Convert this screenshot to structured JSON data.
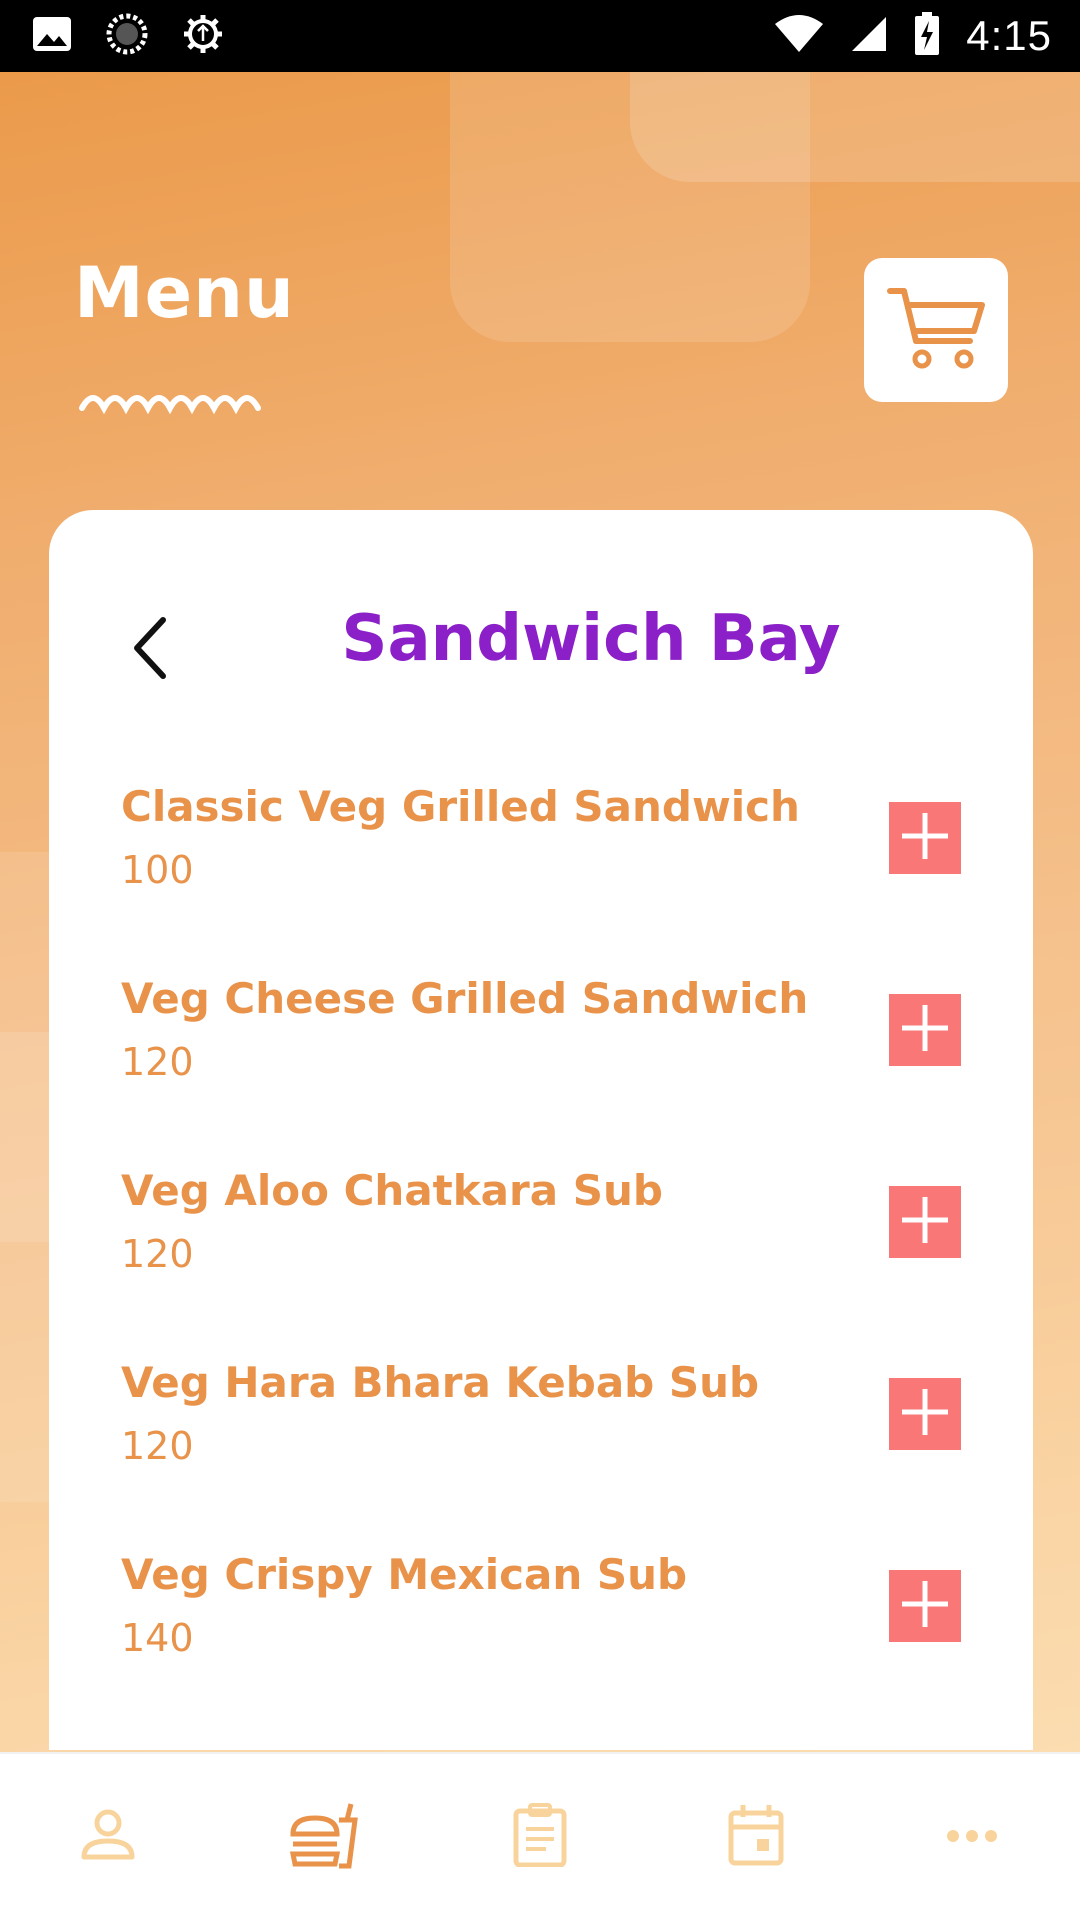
{
  "status_bar": {
    "time": "4:15",
    "left_icons": [
      "image-icon",
      "loading-icon",
      "settings-icon"
    ],
    "right_icons": [
      "wifi-icon",
      "signal-icon",
      "battery-icon"
    ]
  },
  "header": {
    "title": "Menu",
    "cart_icon": "cart-icon"
  },
  "card": {
    "title": "Sandwich Bay",
    "back_icon": "chevron-left-icon",
    "items": [
      {
        "name": "Classic Veg Grilled Sandwich",
        "price": "100"
      },
      {
        "name": "Veg Cheese Grilled Sandwich",
        "price": "120"
      },
      {
        "name": "Veg Aloo Chatkara Sub",
        "price": "120"
      },
      {
        "name": "Veg Hara Bhara Kebab Sub",
        "price": "120"
      },
      {
        "name": "Veg Crispy Mexican Sub",
        "price": "140"
      }
    ]
  },
  "bottom_nav": {
    "items": [
      "profile-icon",
      "food-icon",
      "orders-icon",
      "calendar-icon",
      "more-icon"
    ],
    "active_index": 1
  },
  "colors": {
    "accent": "#e8924a",
    "title_purple": "#8b1fc8",
    "add_button": "#f97777",
    "nav_inactive": "#f8d49c",
    "nav_active": "#e8924a"
  }
}
